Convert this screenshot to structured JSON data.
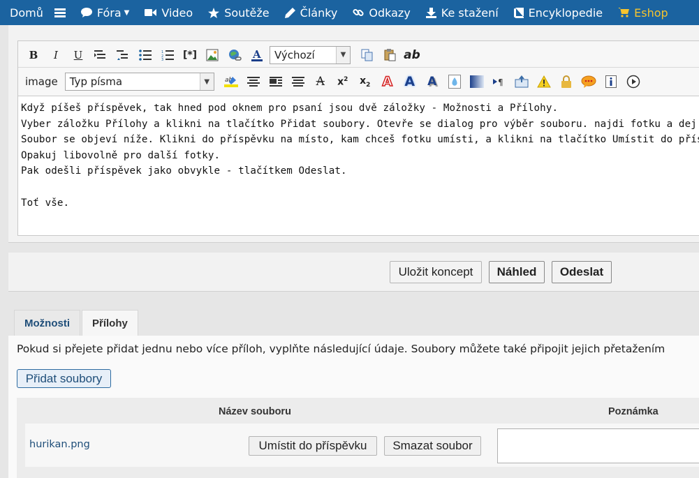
{
  "nav": {
    "items": [
      {
        "label": "Domů",
        "icon": "home-icon"
      },
      {
        "label": "",
        "icon": "menu-icon"
      },
      {
        "label": "Fóra",
        "icon": "chat-bubble-icon"
      },
      {
        "label": "Video",
        "icon": "video-camera-icon"
      },
      {
        "label": "Soutěže",
        "icon": "star-icon"
      },
      {
        "label": "Články",
        "icon": "pencil-icon"
      },
      {
        "label": "Odkazy",
        "icon": "link-icon"
      },
      {
        "label": "Ke stažení",
        "icon": "download-icon"
      },
      {
        "label": "Encyklopedie",
        "icon": "book-icon"
      },
      {
        "label": "Eshop",
        "icon": "cart-icon"
      }
    ],
    "eshop_color": "#f6c42e",
    "bar_color": "#1b63a0"
  },
  "editor": {
    "toolbar1": {
      "style_select": "Výchozí"
    },
    "toolbar2": {
      "image_label": "image",
      "font_select": "Typ písma"
    },
    "body_lines": [
      "Když píšeš příspěvek, tak hned pod oknem pro psaní jsou dvě záložky - Možnosti a Přílohy.",
      "Vyber záložku Přílohy a klikni na tlačítko Přidat soubory. Otevře se dialog pro výběr souboru. najdi fotku a dej OK (nebo Otevřít).",
      "Soubor se objeví níže. Klikni do příspěvku na místo, kam chceš fotku umísti, a klikni na tlačítko Umístit do příspěvku.",
      "Opakuj libovolně pro další fotky.",
      "Pak odešli příspěvek jako obvykle - tlačítkem Odeslat.",
      "",
      "Toť vše."
    ]
  },
  "actions": {
    "save_draft": "Uložit koncept",
    "preview": "Náhled",
    "submit": "Odeslat"
  },
  "tabs": [
    {
      "label": "Možnosti"
    },
    {
      "label": "Přílohy"
    }
  ],
  "attachments": {
    "info": "Pokud si přejete přidat jednu nebo více příloh, vyplňte následující údaje. Soubory můžete také připojit jejich přetažením",
    "add_button": "Přidat soubory",
    "col_filename": "Název souboru",
    "col_note": "Poznámka",
    "files": [
      {
        "name": "hurikan.png",
        "place_button": "Umístit do příspěvku",
        "delete_button": "Smazat soubor",
        "note": ""
      }
    ]
  }
}
